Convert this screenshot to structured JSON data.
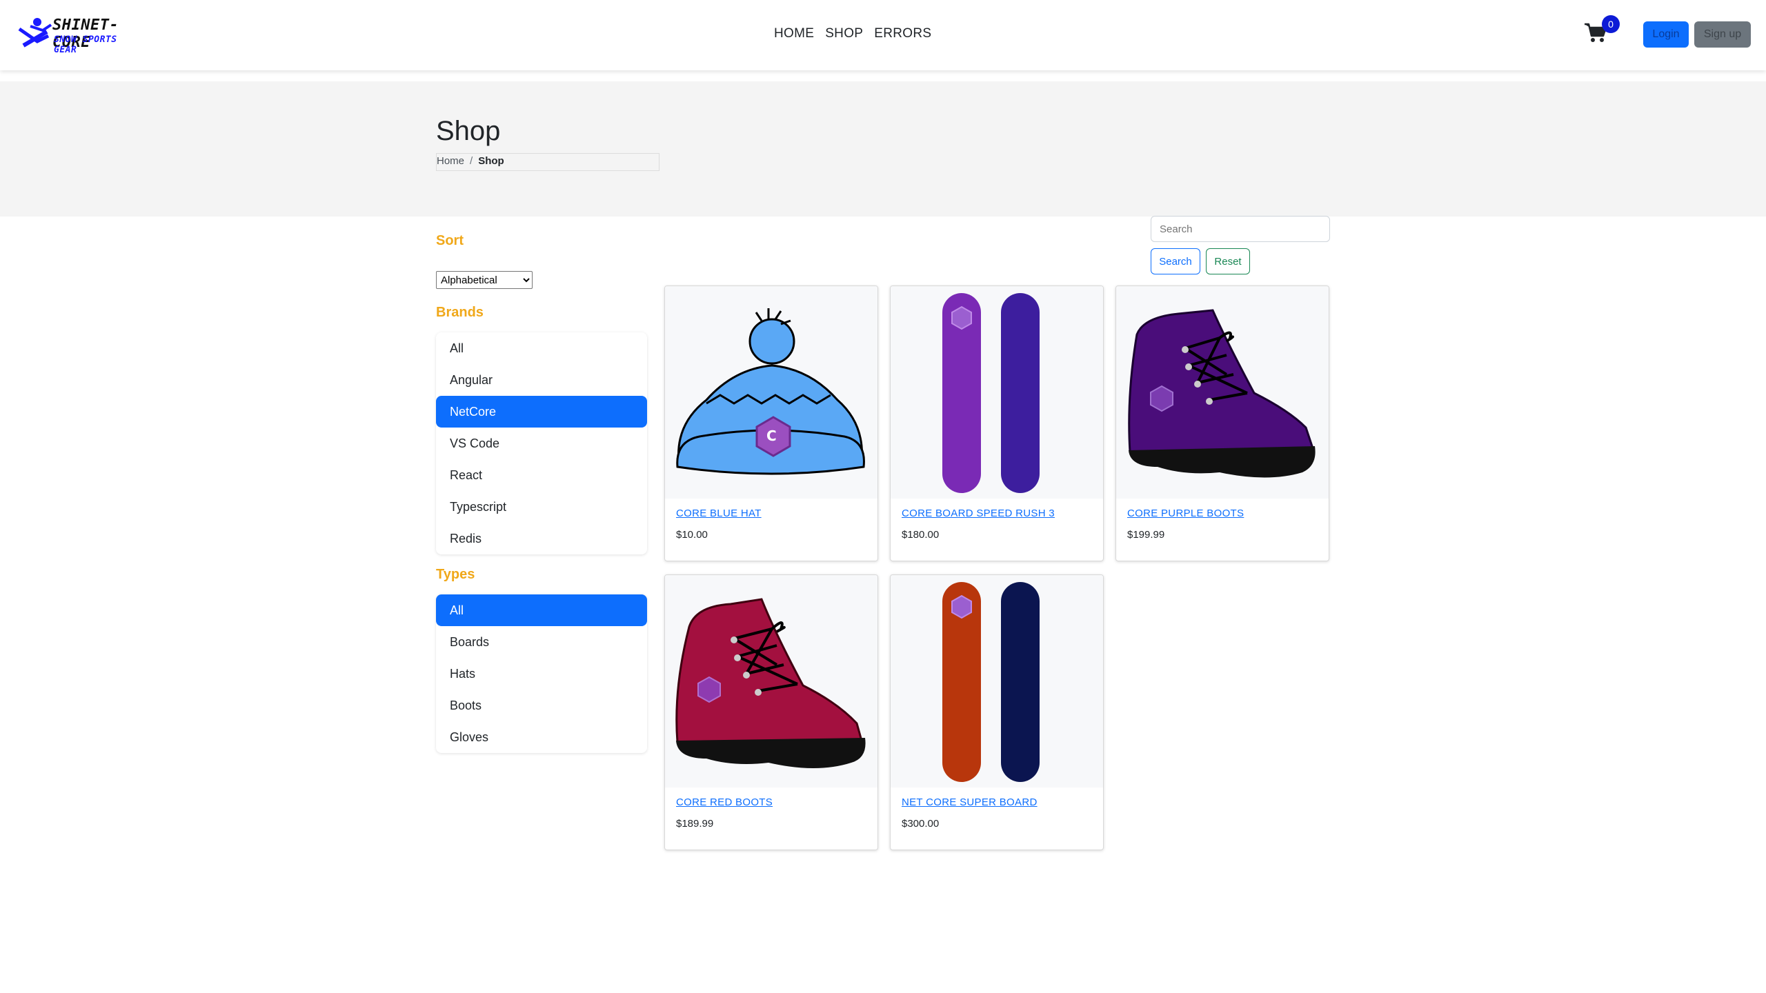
{
  "brand": {
    "name": "SHINET-CORE",
    "tagline": "SNOW SPORTS GEAR"
  },
  "nav": {
    "links": [
      "HOME",
      "SHOP",
      "ERRORS"
    ],
    "cart_count": "0",
    "login_label": "Login",
    "signup_label": "Sign up"
  },
  "header": {
    "title": "Shop",
    "breadcrumb": [
      "Home",
      "Shop"
    ]
  },
  "sidebar": {
    "sort_title": "Sort",
    "sort_selected": "Alphabetical",
    "brands_title": "Brands",
    "brands": [
      "All",
      "Angular",
      "NetCore",
      "VS Code",
      "React",
      "Typescript",
      "Redis"
    ],
    "brands_active": "NetCore",
    "types_title": "Types",
    "types": [
      "All",
      "Boards",
      "Hats",
      "Boots",
      "Gloves"
    ],
    "types_active": "All"
  },
  "search": {
    "placeholder": "Search",
    "search_label": "Search",
    "reset_label": "Reset"
  },
  "products": [
    {
      "name": "CORE BLUE HAT",
      "price": "$10.00",
      "image": "blue-hat"
    },
    {
      "name": "CORE BOARD SPEED RUSH 3",
      "price": "$180.00",
      "image": "purple-boards"
    },
    {
      "name": "CORE PURPLE BOOTS",
      "price": "$199.99",
      "image": "purple-boot"
    },
    {
      "name": "CORE RED BOOTS",
      "price": "$189.99",
      "image": "red-boot"
    },
    {
      "name": "NET CORE SUPER BOARD",
      "price": "$300.00",
      "image": "orange-navy-boards"
    }
  ],
  "colors": {
    "accent": "#0d6efd",
    "section_title": "#f0a81a",
    "header_band": "#f4f4f4"
  }
}
